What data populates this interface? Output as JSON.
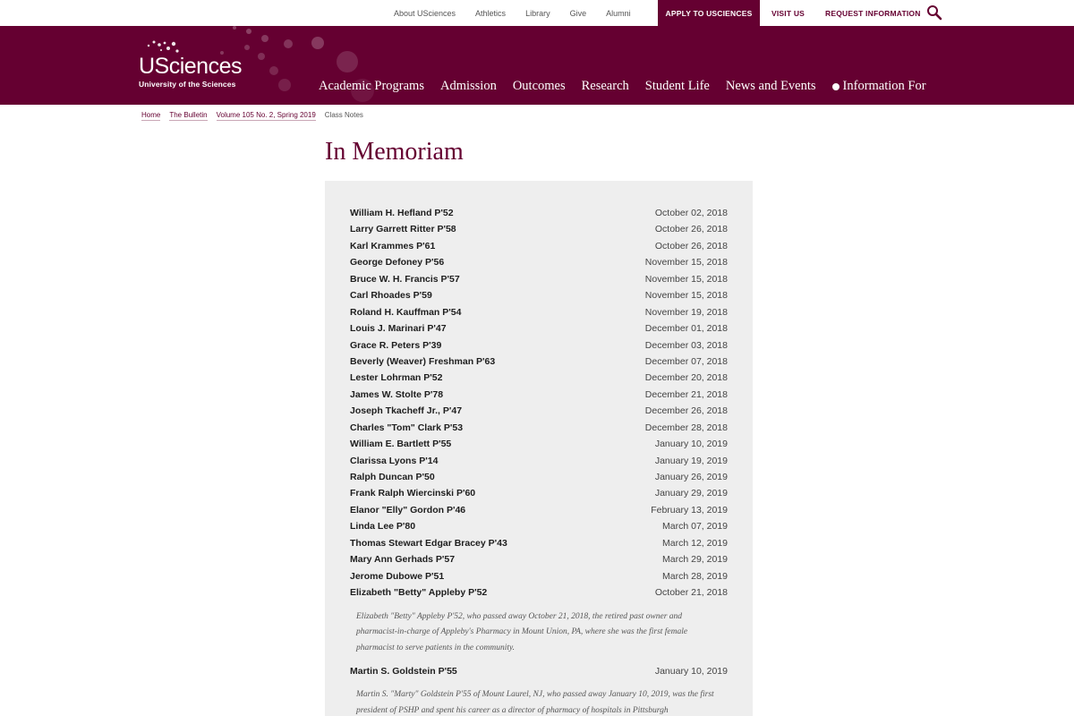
{
  "utility_nav": {
    "links": [
      "About USciences",
      "Athletics",
      "Library",
      "Give",
      "Alumni"
    ],
    "apply": "APPLY TO USCIENCES",
    "visit": "VISIT US",
    "request": "REQUEST INFORMATION"
  },
  "brand": {
    "name": "USciences",
    "subtitle": "University of the Sciences",
    "color": "#650031"
  },
  "main_nav": {
    "items": [
      "Academic Programs",
      "Admission",
      "Outcomes",
      "Research",
      "Student Life",
      "News and Events"
    ],
    "info_for": "Information For"
  },
  "breadcrumb": {
    "items": [
      "Home",
      "The Bulletin",
      "Volume 105 No. 2, Spring 2019"
    ],
    "current": "Class Notes"
  },
  "page": {
    "title": "In Memoriam"
  },
  "memoriam": {
    "entries": [
      {
        "name": "William H. Hefland P'52",
        "date": "October 02, 2018"
      },
      {
        "name": "Larry Garrett Ritter P'58",
        "date": "October 26, 2018"
      },
      {
        "name": "Karl Krammes P'61",
        "date": "October 26, 2018"
      },
      {
        "name": "George Defoney P'56",
        "date": "November 15, 2018"
      },
      {
        "name": "Bruce W. H. Francis P'57",
        "date": "November 15, 2018"
      },
      {
        "name": "Carl Rhoades P'59",
        "date": "November 15, 2018"
      },
      {
        "name": "Roland H. Kauffman P'54",
        "date": "November 19, 2018"
      },
      {
        "name": "Louis J. Marinari P'47",
        "date": "December 01, 2018"
      },
      {
        "name": "Grace R. Peters P'39",
        "date": "December 03, 2018"
      },
      {
        "name": "Beverly (Weaver) Freshman P'63",
        "date": "December 07, 2018"
      },
      {
        "name": "Lester Lohrman P'52",
        "date": "December 20, 2018"
      },
      {
        "name": "James W. Stolte P'78",
        "date": "December 21, 2018"
      },
      {
        "name": "Joseph Tkacheff Jr., P'47",
        "date": "December 26, 2018"
      },
      {
        "name": "Charles \"Tom\" Clark P'53",
        "date": "December 28, 2018"
      },
      {
        "name": "William E. Bartlett P'55",
        "date": "January 10, 2019"
      },
      {
        "name": "Clarissa Lyons P'14",
        "date": "January 19, 2019"
      },
      {
        "name": "Ralph Duncan P'50",
        "date": "January 26, 2019"
      },
      {
        "name": "Frank Ralph Wiercinski P'60",
        "date": "January 29, 2019"
      },
      {
        "name": "Elanor \"Elly\" Gordon P'46",
        "date": "February 13, 2019"
      },
      {
        "name": "Linda Lee P'80",
        "date": "March 07, 2019"
      },
      {
        "name": "Thomas Stewart Edgar Bracey P'43",
        "date": "March 12, 2019"
      },
      {
        "name": "Mary Ann Gerhads P'57",
        "date": "March 29, 2019"
      },
      {
        "name": "Jerome Dubowe P'51",
        "date": "March 28, 2019"
      },
      {
        "name": "Elizabeth \"Betty\" Appleby P'52",
        "date": "October 21, 2018"
      }
    ],
    "appleby_note": "Elizabeth \"Betty\" Appleby P'52, who passed away October 21, 2018, the retired past owner and pharmacist-in-charge of Appleby's Pharmacy in Mount Union, PA, where she was the first female pharmacist to serve patients in the community.",
    "goldstein": {
      "name": "Martin S. Goldstein P'55",
      "date": "January 10, 2019"
    },
    "goldstein_note": "Martin S. \"Marty\" Goldstein P'55 of Mount Laurel, NJ, who passed away January 10, 2019, was the first president of PSHP and spent his career as a director of pharmacy of hospitals in Pittsburgh"
  }
}
